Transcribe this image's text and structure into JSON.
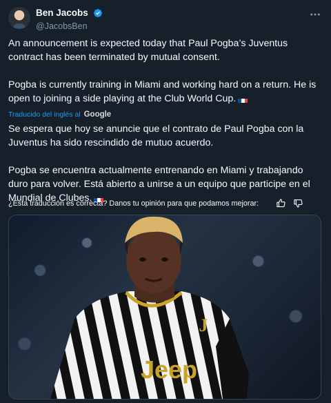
{
  "author": {
    "display_name": "Ben Jacobs",
    "handle": "@JacobsBen",
    "verified": true,
    "verified_color": "#1d9bf0"
  },
  "tweet": {
    "paragraphs": [
      "An announcement is expected today that Paul Pogba’s Juventus contract has been terminated by mutual consent.",
      "Pogba is currently training in Miami and working hard on a return. He is open to joining a side playing at the Club World Cup."
    ],
    "flag_icon": "france-flag-icon"
  },
  "translation": {
    "label": "Traducido del inglés al",
    "provider": "Google",
    "paragraphs": [
      "Se espera que hoy se anuncie que el contrato de Paul Pogba con la Juventus ha sido rescindido de mutuo acuerdo.",
      "Pogba se encuentra actualmente entrenando en Miami y trabajando duro para volver. Está abierto a unirse a un equipo que participe en el Mundial de Clubes."
    ],
    "feedback_prompt": "¿Esta traducción es correcta? Danos tu opinión para que podamos mejorar:"
  },
  "media": {
    "jersey_text": "Jeep",
    "jersey_badge": "J"
  },
  "colors": {
    "background": "#15202b",
    "text": "#f7f9f9",
    "secondary_text": "#8b98a5",
    "link": "#1d9bf0"
  }
}
